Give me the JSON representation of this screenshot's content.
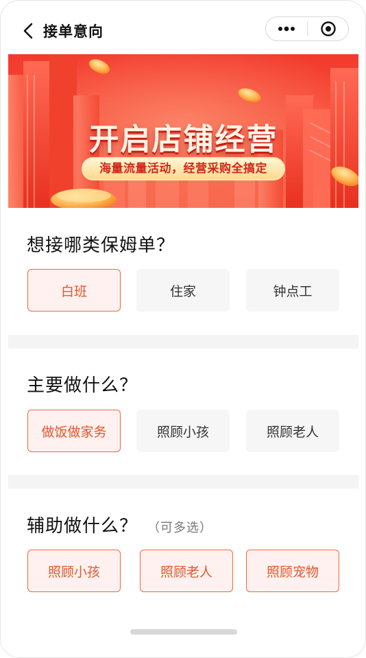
{
  "header": {
    "title": "接单意向",
    "back_icon": "chevron-left-icon",
    "more_icon": "more-dots-icon",
    "close_icon": "target-circle-icon"
  },
  "banner": {
    "title": "开启店铺经营",
    "subtitle": "海量流量活动，经营采购全搞定"
  },
  "sections": [
    {
      "title": "想接哪类保姆单？",
      "hint": "",
      "options": [
        {
          "label": "白班",
          "selected": true
        },
        {
          "label": "住家",
          "selected": false
        },
        {
          "label": "钟点工",
          "selected": false
        }
      ]
    },
    {
      "title": "主要做什么？",
      "hint": "",
      "options": [
        {
          "label": "做饭做家务",
          "selected": true
        },
        {
          "label": "照顾小孩",
          "selected": false
        },
        {
          "label": "照顾老人",
          "selected": false
        }
      ]
    },
    {
      "title": "辅助做什么？",
      "hint": "（可多选）",
      "options": [
        {
          "label": "照顾小孩",
          "selected": true
        },
        {
          "label": "照顾老人",
          "selected": true
        },
        {
          "label": "照顾宠物",
          "selected": true
        }
      ]
    }
  ],
  "colors": {
    "accent": "#ea6a3e",
    "accent_bg": "#fff1ef",
    "banner_red": "#f33a2c"
  }
}
